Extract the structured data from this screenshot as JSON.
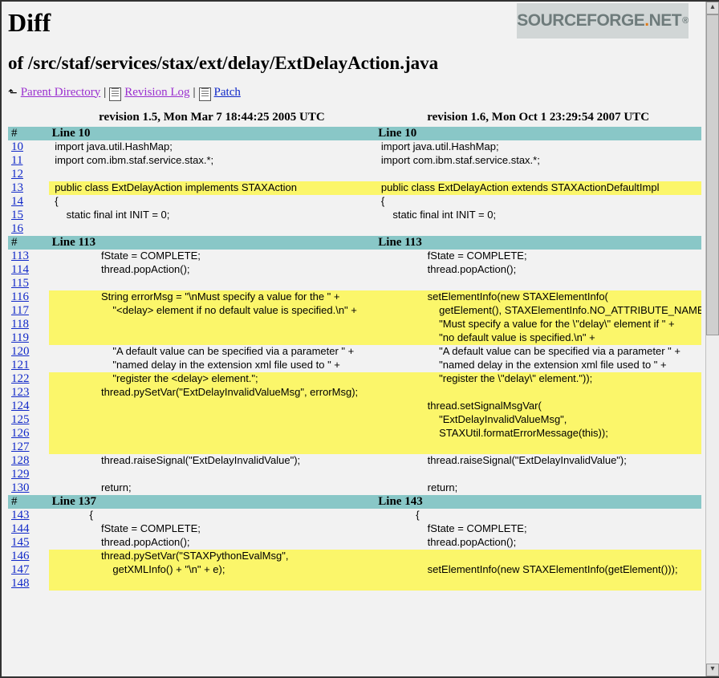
{
  "logo": {
    "text1": "SOURCEFORGE",
    "dot": ".",
    "text2": "NET",
    "sup": "®"
  },
  "heading": {
    "diff": "Diff",
    "path": "of /src/staf/services/stax/ext/delay/ExtDelayAction.java"
  },
  "nav": {
    "parent": " Parent Directory",
    "revision": " Revision Log",
    "patch": " Patch"
  },
  "revHeader": {
    "left": "revision 1.5, Mon Mar 7 18:44:25 2005 UTC",
    "right": "revision 1.6, Mon Oct 1 23:29:54 2007 UTC"
  },
  "sections": [
    {
      "hash": "#",
      "leftLabel": "Line 10",
      "rightLabel": "Line 10",
      "rows": [
        {
          "n": "10",
          "l": " import java.util.HashMap;",
          "r": " import java.util.HashMap;"
        },
        {
          "n": "11",
          "l": " import com.ibm.staf.service.stax.*;",
          "r": " import com.ibm.staf.service.stax.*;"
        },
        {
          "n": "12",
          "l": "",
          "r": ""
        },
        {
          "n": "13",
          "l": " public class ExtDelayAction implements STAXAction",
          "r": " public class ExtDelayAction extends STAXActionDefaultImpl",
          "diff": true
        },
        {
          "n": "14",
          "l": " {",
          "r": " {"
        },
        {
          "n": "15",
          "l": "     static final int INIT = 0;",
          "r": "     static final int INIT = 0;"
        },
        {
          "n": "16",
          "l": "",
          "r": ""
        }
      ]
    },
    {
      "hash": "#",
      "leftLabel": "Line 113",
      "rightLabel": "Line 113",
      "rows": [
        {
          "n": "113",
          "l": "                 fState = COMPLETE;",
          "r": "                 fState = COMPLETE;"
        },
        {
          "n": "114",
          "l": "                 thread.popAction();",
          "r": "                 thread.popAction();"
        },
        {
          "n": "115",
          "l": "",
          "r": ""
        },
        {
          "n": "116",
          "l": "                 String errorMsg = \"\\nMust specify a value for the \" +",
          "r": "                 setElementInfo(new STAXElementInfo(",
          "diff": true
        },
        {
          "n": "117",
          "l": "                     \"<delay> element if no default value is specified.\\n\" +",
          "r": "                     getElement(), STAXElementInfo.NO_ATTRIBUTE_NAME,",
          "diff": true
        },
        {
          "n": "118",
          "l": "",
          "r": "                     \"Must specify a value for the \\\"delay\\\" element if \" +",
          "diff": true
        },
        {
          "n": "119",
          "l": "",
          "r": "                     \"no default value is specified.\\n\" +",
          "diff": true
        },
        {
          "n": "120",
          "l": "                     \"A default value can be specified via a parameter \" +",
          "r": "                     \"A default value can be specified via a parameter \" +"
        },
        {
          "n": "121",
          "l": "                     \"named delay in the extension xml file used to \" +",
          "r": "                     \"named delay in the extension xml file used to \" +"
        },
        {
          "n": "122",
          "l": "                     \"register the <delay> element.\";",
          "r": "                     \"register the \\\"delay\\\" element.\"));",
          "diff": true
        },
        {
          "n": "123",
          "l": "                 thread.pySetVar(\"ExtDelayInvalidValueMsg\", errorMsg);",
          "r": "",
          "diff": true
        },
        {
          "n": "124",
          "l": "",
          "r": "                 thread.setSignalMsgVar(",
          "diff": true
        },
        {
          "n": "125",
          "l": "",
          "r": "                     \"ExtDelayInvalidValueMsg\",",
          "diff": true
        },
        {
          "n": "126",
          "l": "",
          "r": "                     STAXUtil.formatErrorMessage(this));",
          "diff": true
        },
        {
          "n": "127",
          "l": "",
          "r": "",
          "diff": true
        },
        {
          "n": "128",
          "l": "                 thread.raiseSignal(\"ExtDelayInvalidValue\");",
          "r": "                 thread.raiseSignal(\"ExtDelayInvalidValue\");"
        },
        {
          "n": "129",
          "l": "",
          "r": ""
        },
        {
          "n": "130",
          "l": "                 return;",
          "r": "                 return;"
        }
      ]
    },
    {
      "hash": "#",
      "leftLabel": "Line 137",
      "rightLabel": "Line 143",
      "rows": [
        {
          "n": "143",
          "l": "             {",
          "r": "             {"
        },
        {
          "n": "144",
          "l": "                 fState = COMPLETE;",
          "r": "                 fState = COMPLETE;"
        },
        {
          "n": "145",
          "l": "                 thread.popAction();",
          "r": "                 thread.popAction();"
        },
        {
          "n": "146",
          "l": "                 thread.pySetVar(\"STAXPythonEvalMsg\",",
          "r": "",
          "diff": true
        },
        {
          "n": "147",
          "l": "                     getXMLInfo() + \"\\n\" + e);",
          "r": "                 setElementInfo(new STAXElementInfo(getElement()));",
          "diff": true
        },
        {
          "n": "148",
          "l": "",
          "r": "",
          "diff": true
        }
      ]
    }
  ]
}
